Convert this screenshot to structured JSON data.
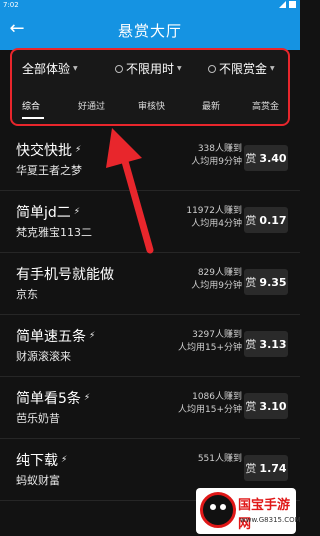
{
  "status_bar": {
    "time": "7:02"
  },
  "app_bar": {
    "back_icon": "←",
    "title": "悬赏大厅"
  },
  "filters": [
    {
      "label": "全部体验"
    },
    {
      "label": "不限用时"
    },
    {
      "label": "不限赏金"
    }
  ],
  "sort_tabs": [
    "综合",
    "好通过",
    "审核快",
    "最新",
    "高赏金"
  ],
  "tasks": [
    {
      "name": "快交快批",
      "flash": true,
      "sub": "华夏王者之梦",
      "earned": "338人赚到",
      "time": "人均用9分钟",
      "reward_label": "赏",
      "reward": "3.40"
    },
    {
      "name": "简单jd二",
      "flash": true,
      "sub": "梵克雅宝113二",
      "earned": "11972人赚到",
      "time": "人均用4分钟",
      "reward_label": "赏",
      "reward": "0.17"
    },
    {
      "name": "有手机号就能做",
      "flash": false,
      "sub": "京东",
      "earned": "829人赚到",
      "time": "人均用9分钟",
      "reward_label": "赏",
      "reward": "9.35"
    },
    {
      "name": "简单速五条",
      "flash": true,
      "sub": "财源滚滚来",
      "earned": "3297人赚到",
      "time": "人均用15+分钟",
      "reward_label": "赏",
      "reward": "3.13"
    },
    {
      "name": "简单看5条",
      "flash": true,
      "sub": "芭乐奶昔",
      "earned": "1086人赚到",
      "time": "人均用15+分钟",
      "reward_label": "赏",
      "reward": "3.10"
    },
    {
      "name": "纯下载",
      "flash": true,
      "sub": "蚂蚁财富",
      "earned": "551人赚到",
      "time": "",
      "reward_label": "赏",
      "reward": "1.74"
    }
  ],
  "watermark": {
    "text": "国宝手游网",
    "url": "www.G8315.COM"
  }
}
